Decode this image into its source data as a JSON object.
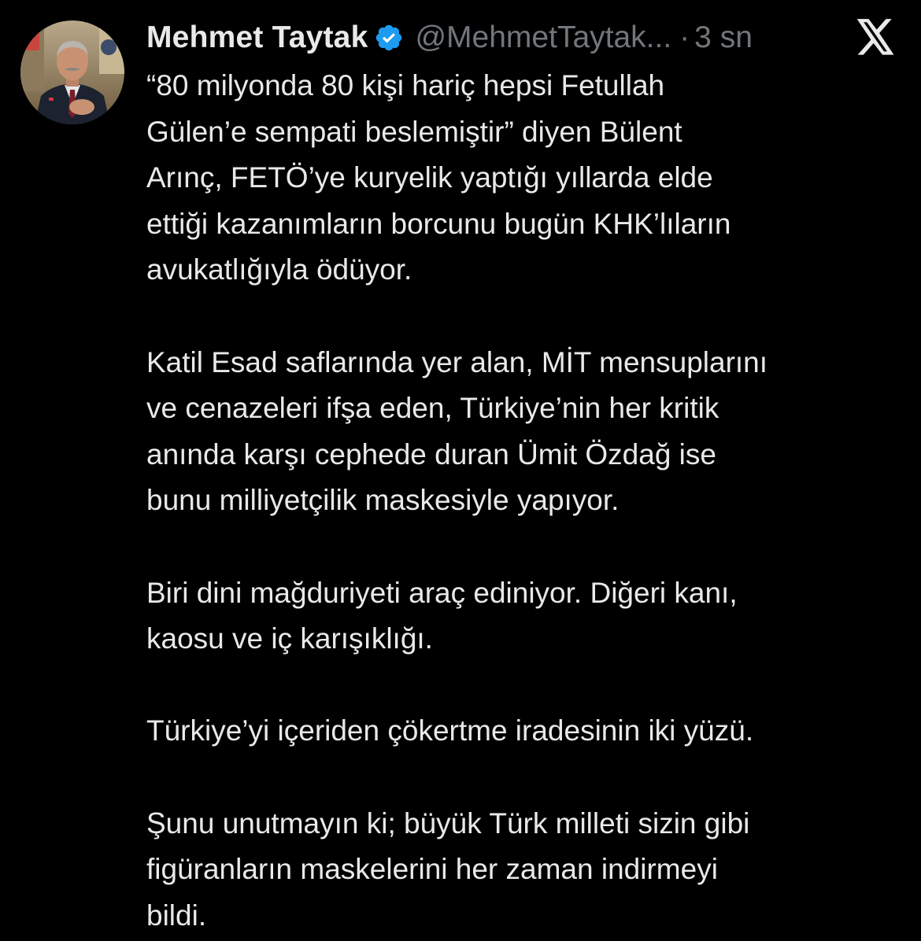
{
  "author": {
    "display_name": "Mehmet Taytak",
    "handle": "@MehmetTaytak...",
    "separator": "·",
    "timestamp": "3 sn",
    "verified": true,
    "verified_color": "#1d9bf0"
  },
  "icons": {
    "verified": "verified-badge-icon",
    "platform": "x-logo-icon"
  },
  "tweet": {
    "paragraphs": [
      "“80 milyonda 80 kişi hariç hepsi Fetullah\nGülen’e sempati beslemiştir”  diyen Bülent\nArınç, FETÖ’ye kuryelik yaptığı yıllarda elde\nettiği kazanımların borcunu  bugün KHK’lıların\navukatlığıyla ödüyor.",
      "Katil Esad saflarında yer alan, MİT mensuplarını\nve cenazeleri ifşa eden,  Türkiye’nin her kritik\nanında karşı cephede duran Ümit Özdağ ise\nbunu milliyetçilik maskesiyle yapıyor.",
      "Biri dini mağduriyeti araç ediniyor. Diğeri kanı,\nkaosu ve iç karışıklığı.",
      "Türkiye’yi içeriden çökertme iradesinin iki yüzü.",
      "Şunu unutmayın ki; büyük Türk milleti sizin gibi\nfigüranların maskelerini her zaman indirmeyi\nbildi."
    ]
  },
  "colors": {
    "background": "#000000",
    "text_primary": "#e7e9ea",
    "text_secondary": "#71767b",
    "accent": "#1d9bf0"
  }
}
